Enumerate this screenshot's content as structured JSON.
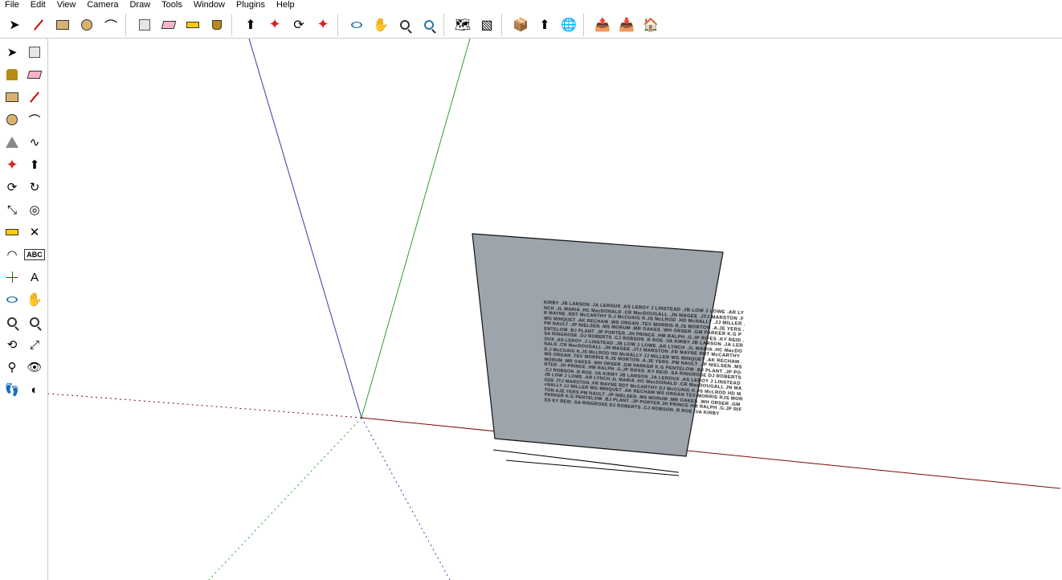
{
  "menu": [
    "File",
    "Edit",
    "View",
    "Camera",
    "Draw",
    "Tools",
    "Window",
    "Plugins",
    "Help"
  ],
  "h_toolbar_names": [
    "select-arrow-icon",
    "pencil-icon",
    "rectangle-icon",
    "circle-icon",
    "arc-icon",
    "make-component-icon",
    "eraser-icon",
    "tape-measure-icon",
    "paint-bucket-icon",
    "sep",
    "push-pull-icon",
    "move-icon",
    "rotate-icon",
    "offset-icon",
    "sep",
    "orbit-icon",
    "pan-icon",
    "zoom-icon",
    "zoom-extents-icon",
    "sep",
    "add-location-icon",
    "toggle-terrain-icon",
    "sep",
    "earth-icon",
    "model-info-icon",
    "warehouse-icon",
    "sep",
    "export-icon",
    "import-icon",
    "house-icon"
  ],
  "v_toolbar_names": [
    "select-arrow-icon",
    "make-component-icon",
    "paint-bucket-icon",
    "eraser-icon",
    "rectangle-icon",
    "pencil-line-icon",
    "circle-icon",
    "arc-icon",
    "polygon-icon",
    "freehand-icon",
    "move-icon",
    "push-pull-icon",
    "rotate-icon",
    "follow-me-icon",
    "scale-icon",
    "offset-icon",
    "tape-measure-icon",
    "dimension-icon",
    "protractor-icon",
    "text-tool-icon",
    "axes-icon",
    "3d-text-icon",
    "orbit-icon",
    "pan-icon",
    "zoom-icon",
    "zoom-window-icon",
    "previous-icon",
    "next-zoom-icon",
    "position-camera-icon",
    "look-around-icon",
    "walk-icon",
    "section-plane-icon"
  ],
  "abc_label": "ABC",
  "plaque_text": "KIRBY .JB    LARSON .JA   LEROUX .AS   LEROY J   LINSTEAD .JB   LOW J    LOWE .AR    LYNCH .JL    MARIA .HC    MacDONALD .CR   MacDOUGALL .JN    MAGEE .JTJ    MARSTON .FR    MAYNE .RDT   McCARTHY D.J   McCUAIG K.JS    McLROD .HD    McNALLY .JJ   MILLER .WG    MINQUET .AK    RECHAM .WS    ORGAN .TEV   MORRIS R.JS   MORTON .A.JE    YERS .PM    NAULT .JP    NIELSEN .MS    MORUM .MR   OAKES .WH   ORSER .GM    PARKER K.G    PENTELOW .BJ    PLANT .JP   PORTER .JH   PRINCE .HM    RALPH .G.JP   RIFES .KY   REID .SA    RINGROSE .DJ    ROBERTS .CJ    ROBSON .R    ROE .VA    KIRBY JB LARSON .JA   LEROUX .AS    LEROY .J    LINSTEAD .JB   LOW J   LOWE .AR   LYNCH .JL   MARIA .HC   MacDONALD .CR   MacDOUGALL .JN   MAGEE .JTJ   MARSTON .FR  MAYNE RDT McCARTHY D.J McCUAIG K.JS McLROD HD McNALLY JJ MILLER WG MINQUET .AK RECHAM .WS ORGAN .TEV MORRIS R.JS MORTON .A.JE YERS .PM NAULT .JP NIELSEN .MS MORUM .MR OAKES .WH ORSER .GM PARKER K.G PENTELOW .BJ PLANT .JP PORTER .JH PRINCE .HM RALPH .G.JP RIFES .KY REID .SA RINGROSE DJ ROBERTS .CJ ROBSON .R ROE .VA KIRBY JB LARSON .JA LEROUX .AS LEROY J LINSTEAD JB LOW J LOWE .AR LYNCH JL MARIA .HC MacDONALD .CR MacDOUGALL JN MAGEE JTJ MARSTON .FR MAYNE RDT McCARTHY DJ McCUAIG K.JS McLROD HD McNALLY JJ MILLER WG MINQUET .AK RECHAM WS ORGAN TEV MORRIS RJS MORTON AJE YERS PM NAULT .JP NIELSEN .MS MORUM .MR OAKES .WH ORSER .GM PARKER K.G PENTELOW .BJ PLANT .JP PORTER JH PRINCE HM RALPH .G.JP RIFES KY REID .SA RINGROSE DJ ROBERTS .CJ ROBSON .R ROE .VA KIRBY"
}
